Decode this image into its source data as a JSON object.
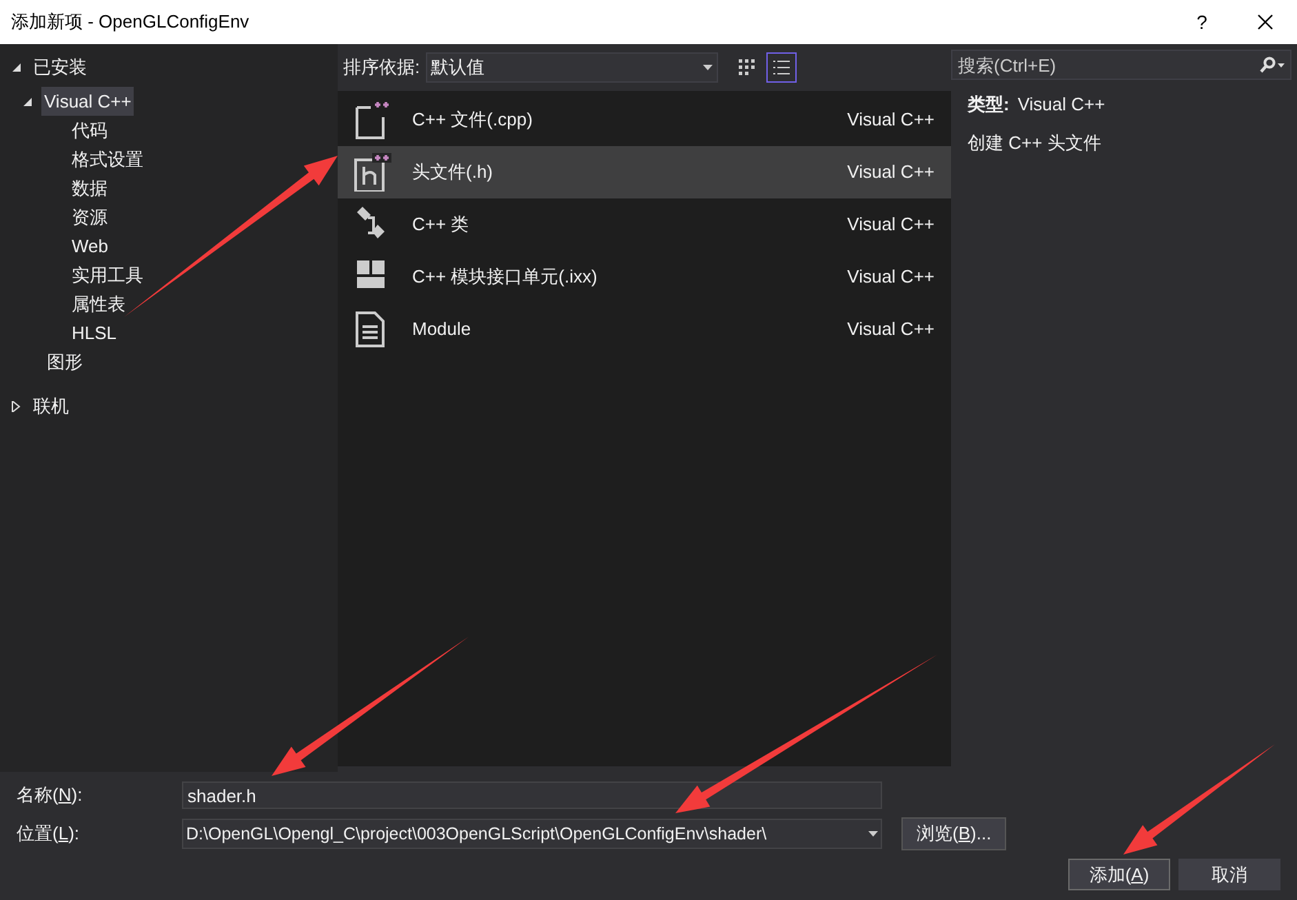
{
  "window": {
    "title": "添加新项 - OpenGLConfigEnv",
    "help": "?"
  },
  "tree": [
    {
      "label": "已安装",
      "expanded": true,
      "selected": false,
      "children": [
        {
          "label": "Visual C++",
          "expanded": true,
          "selected": true,
          "children": [
            {
              "label": "代码",
              "selected": false
            },
            {
              "label": "格式设置",
              "selected": false
            },
            {
              "label": "数据",
              "selected": false
            },
            {
              "label": "资源",
              "selected": false
            },
            {
              "label": "Web",
              "selected": false
            },
            {
              "label": "实用工具",
              "selected": false
            },
            {
              "label": "属性表",
              "selected": false
            },
            {
              "label": "HLSL",
              "selected": false
            }
          ]
        },
        {
          "label": "图形",
          "selected": false
        }
      ]
    },
    {
      "label": "联机",
      "expanded": false,
      "selected": false
    }
  ],
  "sort": {
    "label": "排序依据:",
    "value": "默认值"
  },
  "view_toggle": [
    {
      "kind": "grid",
      "selected": false
    },
    {
      "kind": "list",
      "selected": true
    }
  ],
  "search": {
    "placeholder": "搜索(Ctrl+E)"
  },
  "templates": [
    {
      "kind": "cpp",
      "name": "C++ 文件(.cpp)",
      "language": "Visual C++",
      "selected": false
    },
    {
      "kind": "header",
      "name": "头文件(.h)",
      "language": "Visual C++",
      "selected": true
    },
    {
      "kind": "class",
      "name": "C++ 类",
      "language": "Visual C++",
      "selected": false
    },
    {
      "kind": "module",
      "name": "C++ 模块接口单元(.ixx)",
      "language": "Visual C++",
      "selected": false
    },
    {
      "kind": "doc",
      "name": "Module",
      "language": "Visual C++",
      "selected": false
    }
  ],
  "details": {
    "type_label": "类型:",
    "type_value": "Visual C++",
    "description": "创建 C++ 头文件"
  },
  "name_field": {
    "label": {
      "before": "名称(",
      "key": "N",
      "after": "):"
    },
    "value": "shader.h"
  },
  "location_field": {
    "label": {
      "before": "位置(",
      "key": "L",
      "after": "):"
    },
    "value": "D:\\OpenGL\\Opengl_C\\project\\003OpenGLScript\\OpenGLConfigEnv\\shader\\"
  },
  "browse_button": {
    "before": "浏览(",
    "key": "B",
    "after": ")..."
  },
  "buttons": [
    {
      "kind": "primary",
      "label": {
        "before": "添加(",
        "key": "A",
        "after": ")"
      }
    },
    {
      "kind": "secondary",
      "label": {
        "before": "取消"
      }
    }
  ]
}
